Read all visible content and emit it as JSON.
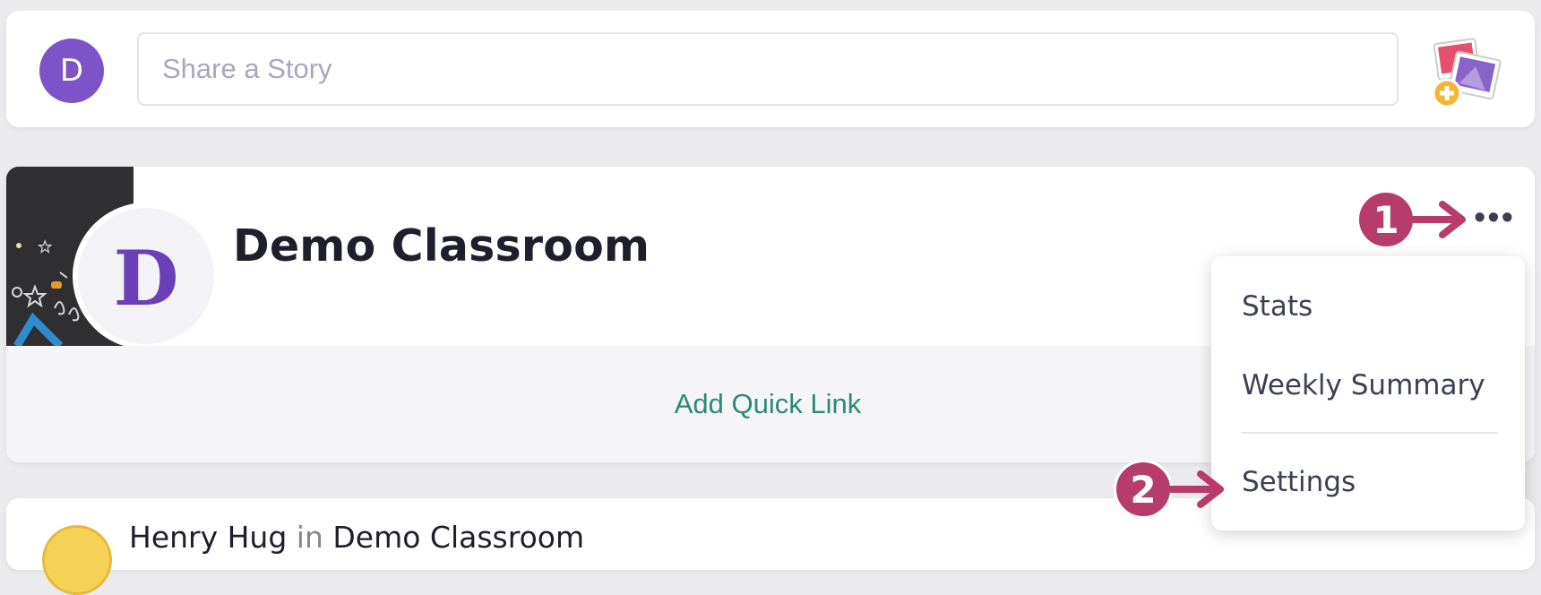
{
  "composer": {
    "avatar_letter": "D",
    "placeholder": "Share a Story",
    "photo_icon": "photo-add-icon"
  },
  "classroom": {
    "title": "Demo Classroom",
    "logo_letter": "D",
    "quick_link_label": "Add Quick Link",
    "more_icon": "more-horizontal-icon",
    "more_label": "•••"
  },
  "menu": {
    "items": [
      "Stats",
      "Weekly Summary",
      "Settings"
    ]
  },
  "post": {
    "author": "Henry Hug",
    "connector": "in",
    "classroom": "Demo Classroom"
  },
  "callouts": [
    "1",
    "2"
  ],
  "colors": {
    "accent": "#7d54c8",
    "link": "#2d8a74",
    "callout": "#b73c6b"
  }
}
